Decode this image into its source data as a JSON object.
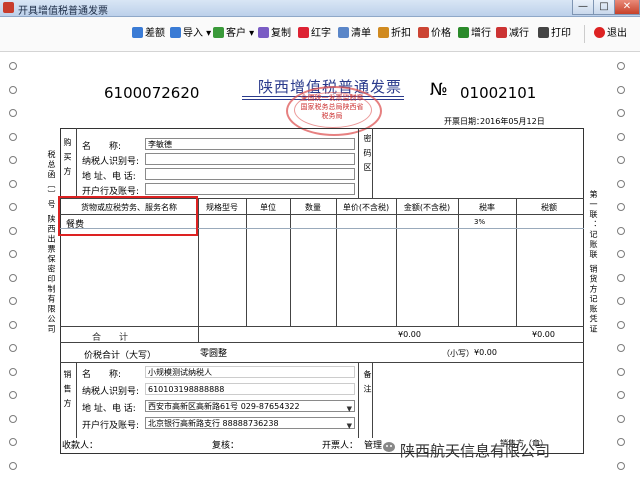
{
  "window": {
    "title": "开具增值税普通发票",
    "min": "—",
    "max": "□",
    "close": "✕"
  },
  "toolbar": [
    {
      "name": "fen-e",
      "label": "差额",
      "color": "#3a7bd5"
    },
    {
      "name": "import",
      "label": "导入 ▾",
      "color": "#3a7bd5"
    },
    {
      "name": "customer",
      "label": "客户 ▾",
      "color": "#3a9a3a"
    },
    {
      "name": "copy",
      "label": "复制",
      "color": "#7a5cc4"
    },
    {
      "name": "red-invoice",
      "label": "红字",
      "color": "#d23"
    },
    {
      "name": "list",
      "label": "清单",
      "color": "#5a86c8"
    },
    {
      "name": "discount",
      "label": "折扣",
      "color": "#d08a20"
    },
    {
      "name": "price",
      "label": "价格",
      "color": "#c43"
    },
    {
      "name": "add-row",
      "label": "增行",
      "color": "#2a8a2a"
    },
    {
      "name": "del-row",
      "label": "减行",
      "color": "#c33"
    },
    {
      "name": "print",
      "label": "打印",
      "color": "#444"
    },
    {
      "name": "exit",
      "label": "退出",
      "color": "#d22"
    }
  ],
  "invoice": {
    "code": "6100072620",
    "title": "陕西增值税普通发票",
    "stamp": "全国统一发票监制章 国家税务总局陕西省税务局",
    "no_mark": "№",
    "number": "01002101",
    "date_label": "开票日期：",
    "date": "2016年05月12日",
    "serial_label": "税总函〔〕号 陕西出票保密印制有限公司",
    "copy_label": "第一联：记账联 销货方记账凭证",
    "buyer": {
      "side": "购 买 方",
      "name_label": "名　　称:",
      "name": "李敏德",
      "tax_label": "纳税人识别号:",
      "tax": "",
      "addr_label": "地 址、电 话:",
      "addr": "",
      "bank_label": "开户行及账号:",
      "bank": ""
    },
    "password_label": "密 码 区",
    "columns": [
      "货物或应税劳务、服务名称",
      "规格型号",
      "单位",
      "数量",
      "单价(不含税)",
      "金额(不含税)",
      "税率",
      "税额"
    ],
    "row1": {
      "name": "餐费",
      "rate": "3%"
    },
    "total_label": "合　　计",
    "total_amount": "¥0.00",
    "total_tax": "¥0.00",
    "sum_label": "价税合计（大写）",
    "sum_upper": "零圆整",
    "sum_small_label": "（小写）",
    "sum_small": "¥0.00",
    "seller": {
      "side": "销 售 方",
      "name_label": "名　　称:",
      "name": "小规模测试纳税人",
      "tax_label": "纳税人识别号:",
      "tax": "610103198888888",
      "addr_label": "地 址、电 话:",
      "addr": "西安市高新区高新路61号 029-87654322",
      "bank_label": "开户行及账号:",
      "bank": "北京银行高新路支行 88888736238"
    },
    "remark_label": "备 注",
    "payee_label": "收款人：",
    "reviewer_label": "复核：",
    "drawer_label": "开票人：",
    "drawer": "管理",
    "seller_sign": "销售方（章）"
  },
  "watermark": "陕西航天信息有限公司"
}
